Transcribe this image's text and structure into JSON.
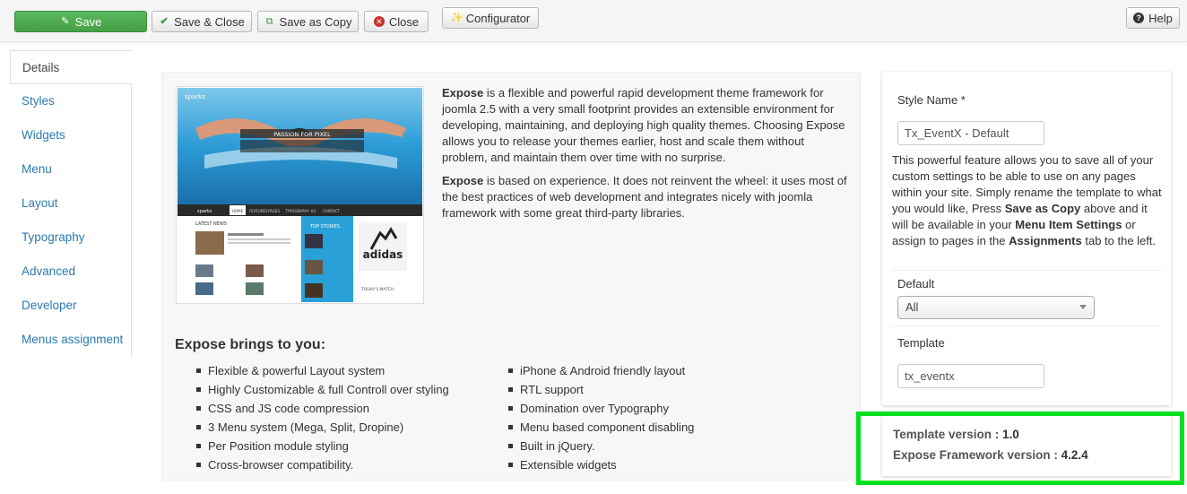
{
  "toolbar": {
    "save_label": "Save",
    "save_close_label": "Save & Close",
    "save_copy_label": "Save as Copy",
    "close_label": "Close",
    "configurator_label": "Configurator",
    "help_label": "Help",
    "colors": {
      "save_bg": "#5cb85c",
      "close_icon": "#c9302c"
    }
  },
  "tabs": [
    "Details",
    "Styles",
    "Widgets",
    "Menu",
    "Layout",
    "Typography",
    "Advanced",
    "Developer",
    "Menus assignment"
  ],
  "preview": {
    "logo": "sparkz",
    "hero_caption": "PASSION FOR PIXEL",
    "nav": [
      "HOME",
      "FEATURES",
      "PAGES",
      "TYPOGRAPHY",
      "K2",
      "CONTACT"
    ],
    "latest_news": "LATEST NEWS",
    "top_stories": "TOP STORIES",
    "todays_match": "TODAY'S MATCH",
    "brand": "adidas"
  },
  "description": {
    "p1_name": "Expose",
    "p1_text": " is a flexible and powerful rapid development theme framework for joomla 2.5 with a very small footprint provides an extensible environment for developing, maintaining, and deploying high quality themes. Choosing Expose allows you to release your themes earlier, host and scale them without problem, and maintain them over time with no surprise.",
    "p2_name": "Expose",
    "p2_text": " is based on experience. It does not reinvent the wheel: it uses most of the best practices of web development and integrates nicely with joomla framework with some great third-party libraries."
  },
  "features": {
    "title": "Expose brings to you:",
    "left": [
      "Flexible & powerful Layout system",
      "Highly Customizable & full Controll over styling",
      "CSS and JS code compression",
      "3 Menu system (Mega, Split, Dropine)",
      "Per Position module styling",
      "Cross-browser compatibility."
    ],
    "right": [
      "iPhone & Android friendly layout",
      "RTL support",
      "Domination over Typography",
      "Menu based component disabling",
      "Built in jQuery.",
      "Extensible widgets"
    ]
  },
  "style_panel": {
    "style_name_label": "Style Name *",
    "style_name_value": "Tx_EventX - Default",
    "help_1": "This powerful feature allows you to save all of your custom settings to be able to use on any pages within your site. Simply rename the template to what you would like, Press ",
    "help_save_as_copy": "Save as Copy",
    "help_2": " above and it will be available in your ",
    "help_menu_item_settings": "Menu Item Settings",
    "help_3": " or assign to pages in the ",
    "help_assignments": "Assignments",
    "help_4": " tab to the left.",
    "default_label": "Default",
    "default_value": "All",
    "template_label": "Template",
    "template_value": "tx_eventx"
  },
  "version": {
    "template_label": "Template version : ",
    "template_value": "1.0",
    "framework_label": "Expose Framework version : ",
    "framework_value": "4.2.4",
    "highlight_color": "#00e020"
  }
}
